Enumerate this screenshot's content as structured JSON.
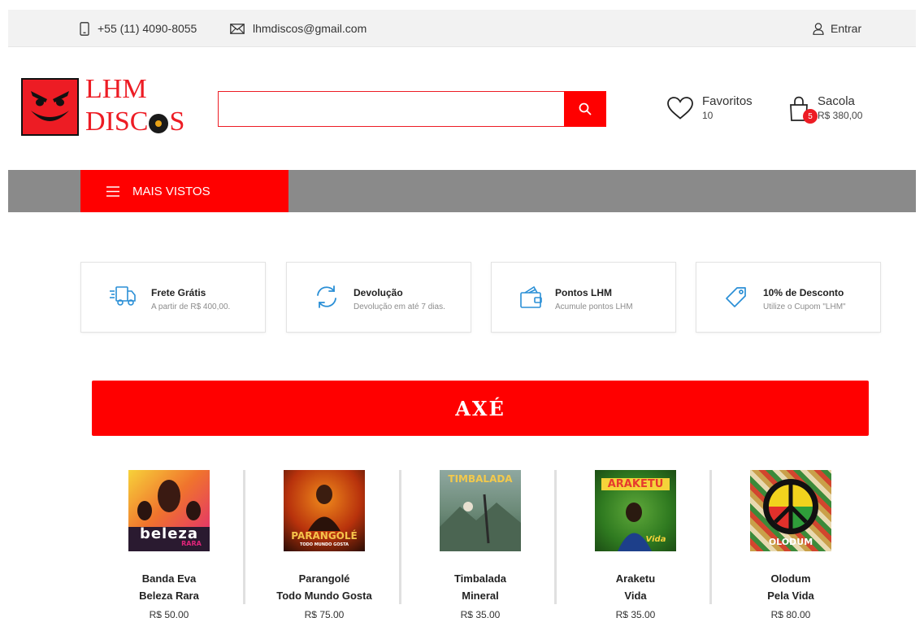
{
  "topbar": {
    "phone": "+55 (11) 4090-8055",
    "email": "lhmdiscos@gmail.com",
    "login": "Entrar",
    "icons": [
      "phone-icon",
      "mail-icon",
      "user-icon"
    ]
  },
  "logo": {
    "line1": "LHM",
    "line2_start": "DISC",
    "line2_end": "S",
    "color": "#ed1c24"
  },
  "search": {
    "value": "",
    "placeholder": "",
    "button_icon": "search-icon"
  },
  "favorites": {
    "label": "Favoritos",
    "count": "10"
  },
  "bag": {
    "label": "Sacola",
    "badge": "5",
    "total": "R$ 380,00"
  },
  "nav": {
    "menu_label": "MAIS VISTOS",
    "menu_icon": "hamburger-icon"
  },
  "features": [
    {
      "icon": "delivery-truck-icon",
      "title": "Frete Grátis",
      "subtitle": "A partir de R$ 400,00."
    },
    {
      "icon": "refresh-icon",
      "title": "Devolução",
      "subtitle": "Devolução em até 7 dias."
    },
    {
      "icon": "wallet-icon",
      "title": "Pontos LHM",
      "subtitle": "Acumule pontos LHM"
    },
    {
      "icon": "tag-icon",
      "title": "10% de Desconto",
      "subtitle": "Utilize o Cupom \"LHM\""
    }
  ],
  "section": {
    "title": "AXÉ"
  },
  "products": [
    {
      "artist": "Banda Eva",
      "album": "Beleza Rara",
      "price": "R$ 50,00",
      "cover_text": "beleza",
      "cover_sub": "RARA"
    },
    {
      "artist": "Parangolé",
      "album": "Todo Mundo Gosta",
      "price": "R$ 75,00",
      "cover_text": "PARANGOLÉ",
      "cover_sub": "TODO MUNDO GOSTA"
    },
    {
      "artist": "Timbalada",
      "album": "Mineral",
      "price": "R$ 35,00",
      "cover_text": "TIMBALADA"
    },
    {
      "artist": "Araketu",
      "album": "Vida",
      "price": "R$ 35,00",
      "cover_text": "ARAKETU",
      "cover_sub": "Vida"
    },
    {
      "artist": "Olodum",
      "album": "Pela Vida",
      "price": "R$ 80,00",
      "cover_text": "OLODUM"
    }
  ],
  "colors": {
    "accent": "#ff0000",
    "nav_bg": "#8a8a8a",
    "topbar_bg": "#f2f2f2",
    "feature_icon": "#2a8fd6"
  }
}
